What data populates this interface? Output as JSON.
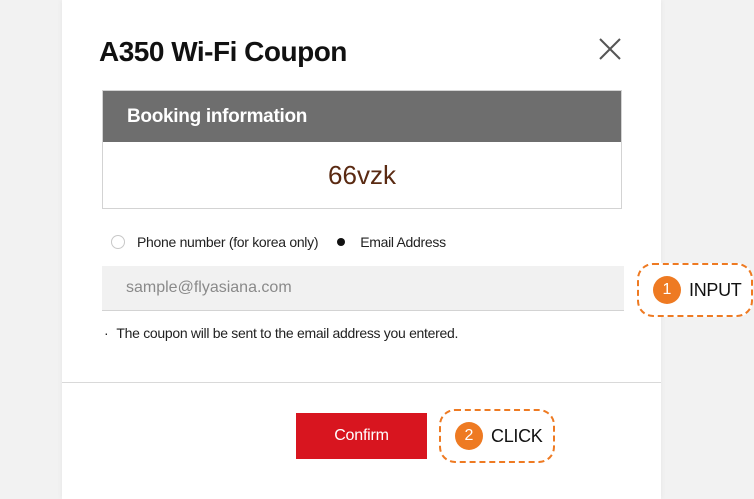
{
  "modal": {
    "title": "A350 Wi-Fi Coupon",
    "close_icon": "close-icon"
  },
  "booking": {
    "header": "Booking information",
    "code": "66vzk"
  },
  "contact": {
    "options": [
      {
        "label": "Phone number (for korea only)",
        "checked": false
      },
      {
        "label": "Email Address",
        "checked": true
      }
    ],
    "email_placeholder": "sample@flyasiana.com",
    "email_value": ""
  },
  "notice": {
    "bullet": "·",
    "text": "The coupon will be sent to the email address you entered."
  },
  "footer": {
    "confirm_label": "Confirm"
  },
  "callouts": {
    "input": {
      "number": "1",
      "text": "INPUT"
    },
    "click": {
      "number": "2",
      "text": "CLICK"
    }
  },
  "colors": {
    "accent_red": "#d8151f",
    "callout_orange": "#ee7a22",
    "header_gray": "#6e6e6e",
    "code_brown": "#5a2a12"
  }
}
